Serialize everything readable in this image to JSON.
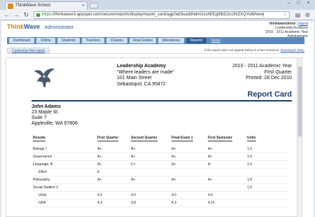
{
  "browser": {
    "tab_title": "ThinkWave School",
    "tab_close": "×",
    "url_scheme": "https",
    "url_rest": "://thinkwave3.appspot.com/secure/reports/display/report_card/agp0aGlua3dhdmUzchEEg9lb3Jzc2hiZXQYo8lAwwj"
  },
  "app": {
    "logo_think": "Think",
    "logo_wave": "Wave",
    "role": "Administrator",
    "user": {
      "username": "thinkwavedemo",
      "separator": " | ",
      "logout": "logout",
      "school": "Leadership Academy",
      "term": "2010 - 2011 Academic Year",
      "role": "Administrator"
    },
    "nav": [
      "Dashboard",
      "Online",
      "Students",
      "Teachers",
      "Classes",
      "Final Grades",
      "Attendance",
      "Reports",
      "Setup"
    ],
    "customize_label": "Customize this report",
    "notice_text": "If the report does not appear below in a few moments, ",
    "notice_link": "download it here."
  },
  "report": {
    "school_name": "Leadership Academy",
    "motto": "\"Where leaders are made\"",
    "street": "101 Main Street",
    "city": "Sebastopol, CA 95472",
    "term_year": "2010 - 2011 Academic Year",
    "term_quarter": "First Quarter",
    "printed": "Printed: 28 Dec 2010",
    "title": "Report Card",
    "student": {
      "name": "John Adams",
      "addr1": "23 Maple St.",
      "addr2": "Suite 7",
      "addr3": "Appleville, WA 97806"
    },
    "columns": [
      "Results",
      "First Quarter",
      "Second Quarter",
      "Final Exam 1",
      "First Semester",
      "Units"
    ],
    "rows": [
      {
        "label": "Biology I",
        "indent": false,
        "q1": "A+",
        "q2": "A+",
        "exam": "A+",
        "sem": "A+",
        "units": "1.0"
      },
      {
        "label": "Governance",
        "indent": false,
        "q1": "A+",
        "q2": "A+",
        "exam": "A+",
        "sem": "A+",
        "units": "1.0"
      },
      {
        "label": "Language, B",
        "indent": false,
        "q1": "A+",
        "q2": "C+",
        "exam": "A+",
        "sem": "A-",
        "units": "1.0"
      },
      {
        "label": "Effort",
        "indent": true,
        "q1": "E",
        "q2": "",
        "exam": "",
        "sem": "",
        "units": ""
      },
      {
        "label": "Philosophy",
        "indent": false,
        "q1": "A+",
        "q2": "A+",
        "exam": "A+",
        "sem": "A+",
        "units": "1.0"
      },
      {
        "label": "Social Studies 3",
        "indent": false,
        "q1": "",
        "q2": "",
        "exam": "",
        "sem": "",
        "units": "1.0"
      },
      {
        "label": "Units",
        "indent": true,
        "q1": "4.0",
        "q2": "4.0",
        "exam": "4.0",
        "sem": "4.0",
        "units": ""
      },
      {
        "label": "GPA",
        "indent": true,
        "q1": "4.3",
        "q2": "3.8",
        "exam": "4.3",
        "sem": "4.15",
        "units": ""
      }
    ]
  },
  "colors": {
    "nav_bar": "#5a8abf",
    "nav_active": "#2d5a9a",
    "title_blue": "#1d3a6a",
    "logo_orange": "#c98a1a"
  },
  "icons": [
    "favicon-icon",
    "back-arrow-icon",
    "forward-arrow-icon",
    "reload-icon",
    "lock-icon",
    "star-icon",
    "page-menu-icon",
    "wrench-icon",
    "eagle-logo-icon"
  ]
}
